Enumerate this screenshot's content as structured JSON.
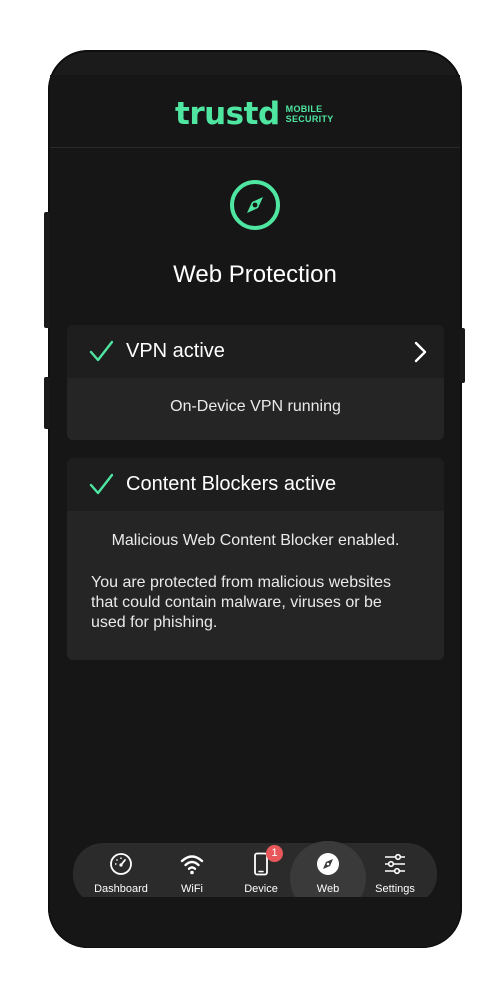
{
  "brand": {
    "name": "trustd",
    "sub_line1": "MOBILE",
    "sub_line2": "SECURITY",
    "accent": "#4ee6a1"
  },
  "page": {
    "icon": "compass-icon",
    "title": "Web Protection"
  },
  "vpn_card": {
    "title": "VPN active",
    "status_icon": "check-icon",
    "body": "On-Device VPN running"
  },
  "blocker_card": {
    "title": "Content Blockers active",
    "status_icon": "check-icon",
    "body_line": "Malicious Web Content Blocker enabled.",
    "body_paragraph": "You are protected from malicious websites that could contain malware, viruses or be used for phishing."
  },
  "nav": {
    "items": [
      {
        "label": "Dashboard",
        "icon": "speedometer-icon"
      },
      {
        "label": "WiFi",
        "icon": "wifi-icon"
      },
      {
        "label": "Device",
        "icon": "phone-icon",
        "badge": "1"
      },
      {
        "label": "Web",
        "icon": "compass-icon",
        "active": true
      },
      {
        "label": "Settings",
        "icon": "sliders-icon"
      }
    ]
  }
}
